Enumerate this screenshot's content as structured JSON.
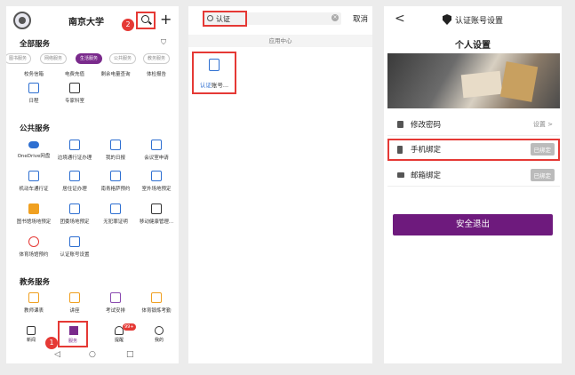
{
  "panel1": {
    "university": "南京大学",
    "search_badge": "2",
    "add_symbol": "+",
    "all_services_title": "全部服务",
    "filter_icon": "filter-icon",
    "chips": [
      "图书服务",
      "网络服务",
      "生活服务",
      "公共服务",
      "教务服务"
    ],
    "active_chip_index": 2,
    "life_row1": [
      "校务信箱",
      "电费充值",
      "剩余电量查询",
      "体检报告"
    ],
    "life_row2": [
      "日程",
      "专家科室"
    ],
    "public_title": "公共服务",
    "public_row1": [
      "OneDrive网盘",
      "边境通行证办理",
      "我的日报",
      "会议室申请"
    ],
    "public_row2": [
      "机动车通行证",
      "居住证办理",
      "南青格萨预约",
      "室外场地预定"
    ],
    "public_row3": [
      "图书馆场地预定",
      "团委场地预定",
      "无犯罪证明",
      "移动健康管理..."
    ],
    "public_row4": [
      "体育场馆预约",
      "认证账号设置"
    ],
    "edu_title": "教务服务",
    "edu_row1": [
      "教师课表",
      "讲座",
      "考试安排",
      "体育锻炼考勤"
    ],
    "nav": [
      "新闻",
      "服务",
      "提醒",
      "我的"
    ],
    "service_badge": "1",
    "notif_count": "99+",
    "sys_buttons": [
      "◁",
      "○",
      "□"
    ]
  },
  "panel2": {
    "search_value": "认证",
    "clear_icon": "×",
    "cancel": "取消",
    "section": "应用中心",
    "result_highlight": "认证",
    "result_rest": "账号..."
  },
  "panel3": {
    "back": "<",
    "title": "认证账号设置",
    "subtitle": "个人设置",
    "rows": {
      "password": {
        "label": "修改密码",
        "value": "设置  >"
      },
      "phone": {
        "label": "手机绑定",
        "tag": "已绑定"
      },
      "email": {
        "label": "邮箱绑定",
        "tag": "已绑定"
      }
    },
    "logout": "安全退出"
  },
  "colors": {
    "accent": "#6e1a7d",
    "highlight_box": "#e53935",
    "icon_blue": "#2e6fd1"
  }
}
